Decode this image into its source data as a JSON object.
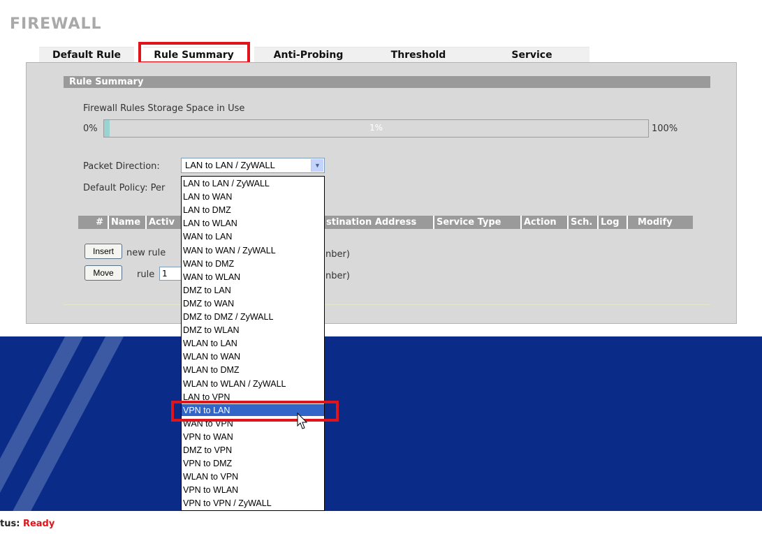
{
  "page": {
    "title": "FIREWALL"
  },
  "tabs": [
    {
      "label": "Default Rule"
    },
    {
      "label": "Rule Summary",
      "active": true
    },
    {
      "label": "Anti-Probing"
    },
    {
      "label": "Threshold"
    },
    {
      "label": "Service"
    }
  ],
  "section": {
    "title": "Rule Summary"
  },
  "storage": {
    "label": "Firewall Rules Storage Space in Use",
    "min_label": "0%",
    "max_label": "100%",
    "value_label": "1%",
    "fraction": 0.01
  },
  "packet_direction": {
    "label": "Packet Direction:",
    "selected": "LAN to LAN / ZyWALL",
    "options": [
      "LAN to LAN / ZyWALL",
      "LAN to WAN",
      "LAN to DMZ",
      "LAN to WLAN",
      "WAN to LAN",
      "WAN to WAN / ZyWALL",
      "WAN to DMZ",
      "WAN to WLAN",
      "DMZ to LAN",
      "DMZ to WAN",
      "DMZ to DMZ / ZyWALL",
      "DMZ to WLAN",
      "WLAN to LAN",
      "WLAN to WAN",
      "WLAN to DMZ",
      "WLAN to WLAN / ZyWALL",
      "LAN to VPN",
      "VPN to LAN",
      "WAN to VPN",
      "VPN to WAN",
      "DMZ to VPN",
      "VPN to DMZ",
      "WLAN to VPN",
      "VPN to WLAN",
      "VPN to VPN / ZyWALL"
    ],
    "highlighted": "VPN to LAN"
  },
  "default_policy": {
    "label": "Default Policy: Per"
  },
  "table": {
    "columns": [
      "#",
      "Name",
      "Activ",
      "stination Address",
      "Service Type",
      "Action",
      "Sch.",
      "Log",
      "Modify"
    ]
  },
  "actions": {
    "insert_label": "Insert",
    "insert_text_left": "new rule",
    "insert_text_right": "nber)",
    "move_label": "Move",
    "move_text_left": "rule",
    "move_value": "1",
    "move_text_right": "nber)"
  },
  "status": {
    "label": "tus:",
    "value": "Ready"
  },
  "colors": {
    "highlight": "#e0141b",
    "selected_item": "#3166c8",
    "background_band": "#0a2b87",
    "panel": "#d9d9d9",
    "header_bar": "#9a9a9a"
  }
}
